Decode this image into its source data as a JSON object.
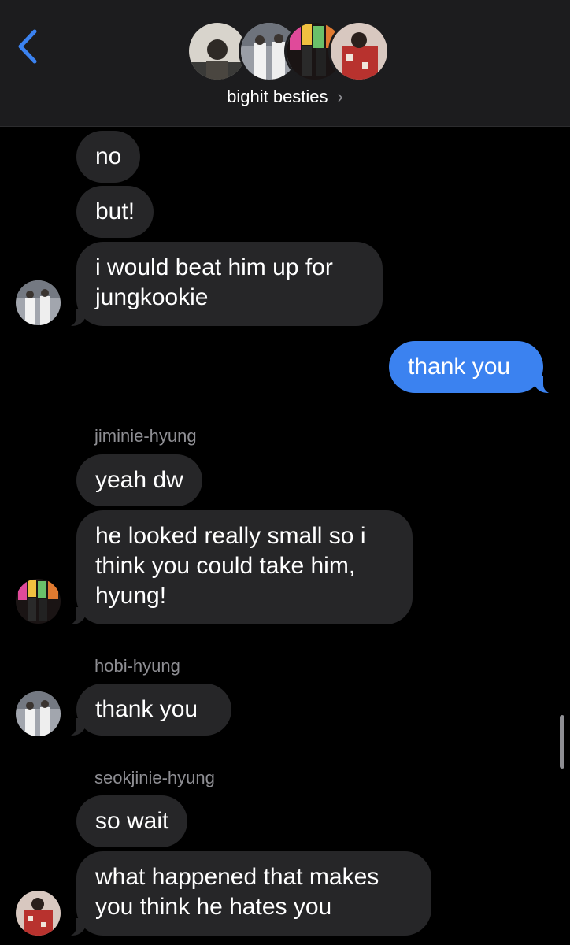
{
  "header": {
    "group_name": "bighit besties",
    "chevron": "›",
    "back_icon": "chevron-left-icon",
    "accent": "#3b82f0"
  },
  "messages": [
    {
      "text": "no",
      "direction": "incoming"
    },
    {
      "text": "but!",
      "direction": "incoming"
    },
    {
      "text": "i would beat him up for jungkookie",
      "direction": "incoming"
    },
    {
      "text": "thank you",
      "direction": "outgoing"
    },
    {
      "sender": "jiminie-hyung"
    },
    {
      "text": "yeah dw",
      "direction": "incoming"
    },
    {
      "text": "he looked really small so i think you could take him, hyung!",
      "direction": "incoming"
    },
    {
      "sender": "hobi-hyung"
    },
    {
      "text": "thank you",
      "direction": "incoming"
    },
    {
      "sender": "seokjinie-hyung"
    },
    {
      "text": "so wait",
      "direction": "incoming"
    },
    {
      "text": "what happened that makes you think he hates you",
      "direction": "incoming"
    }
  ],
  "colors": {
    "incoming_bubble": "#262628",
    "outgoing_bubble": "#3b82f0",
    "background": "#000000",
    "header": "#1c1c1e",
    "secondary_text": "#8e8e93"
  }
}
